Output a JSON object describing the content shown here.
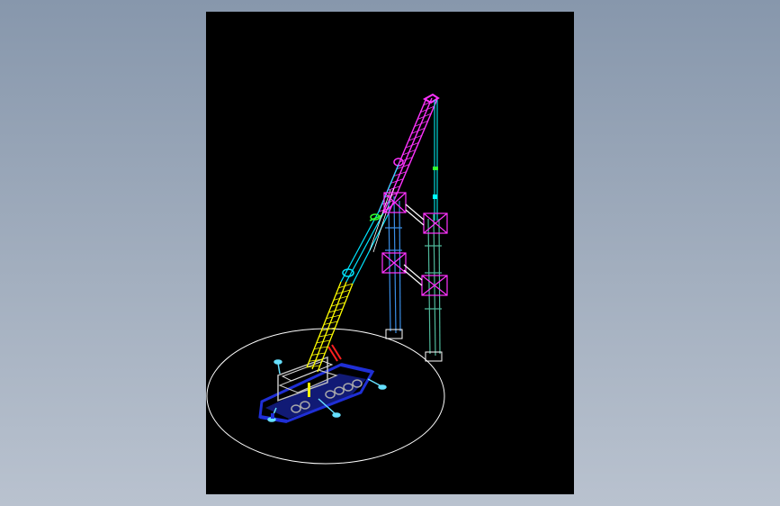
{
  "viewer": {
    "background": "#8e9db0",
    "canvas_background": "#000000"
  },
  "drawing": {
    "subject": "crawler-crane-lifting-assembly",
    "colors": {
      "boom_upper": "#ff33ff",
      "boom_lower": "#ffff00",
      "boom_mid": "#00e5ff",
      "cable": "#00ffff",
      "tower_left": "#3a8ee6",
      "tower_right": "#4fb89a",
      "frame": "#ff33ff",
      "chassis": "#1f2fd6",
      "outline": "#ffffff",
      "hook": "#ff2020",
      "outrigger": "#66e0ff"
    }
  }
}
